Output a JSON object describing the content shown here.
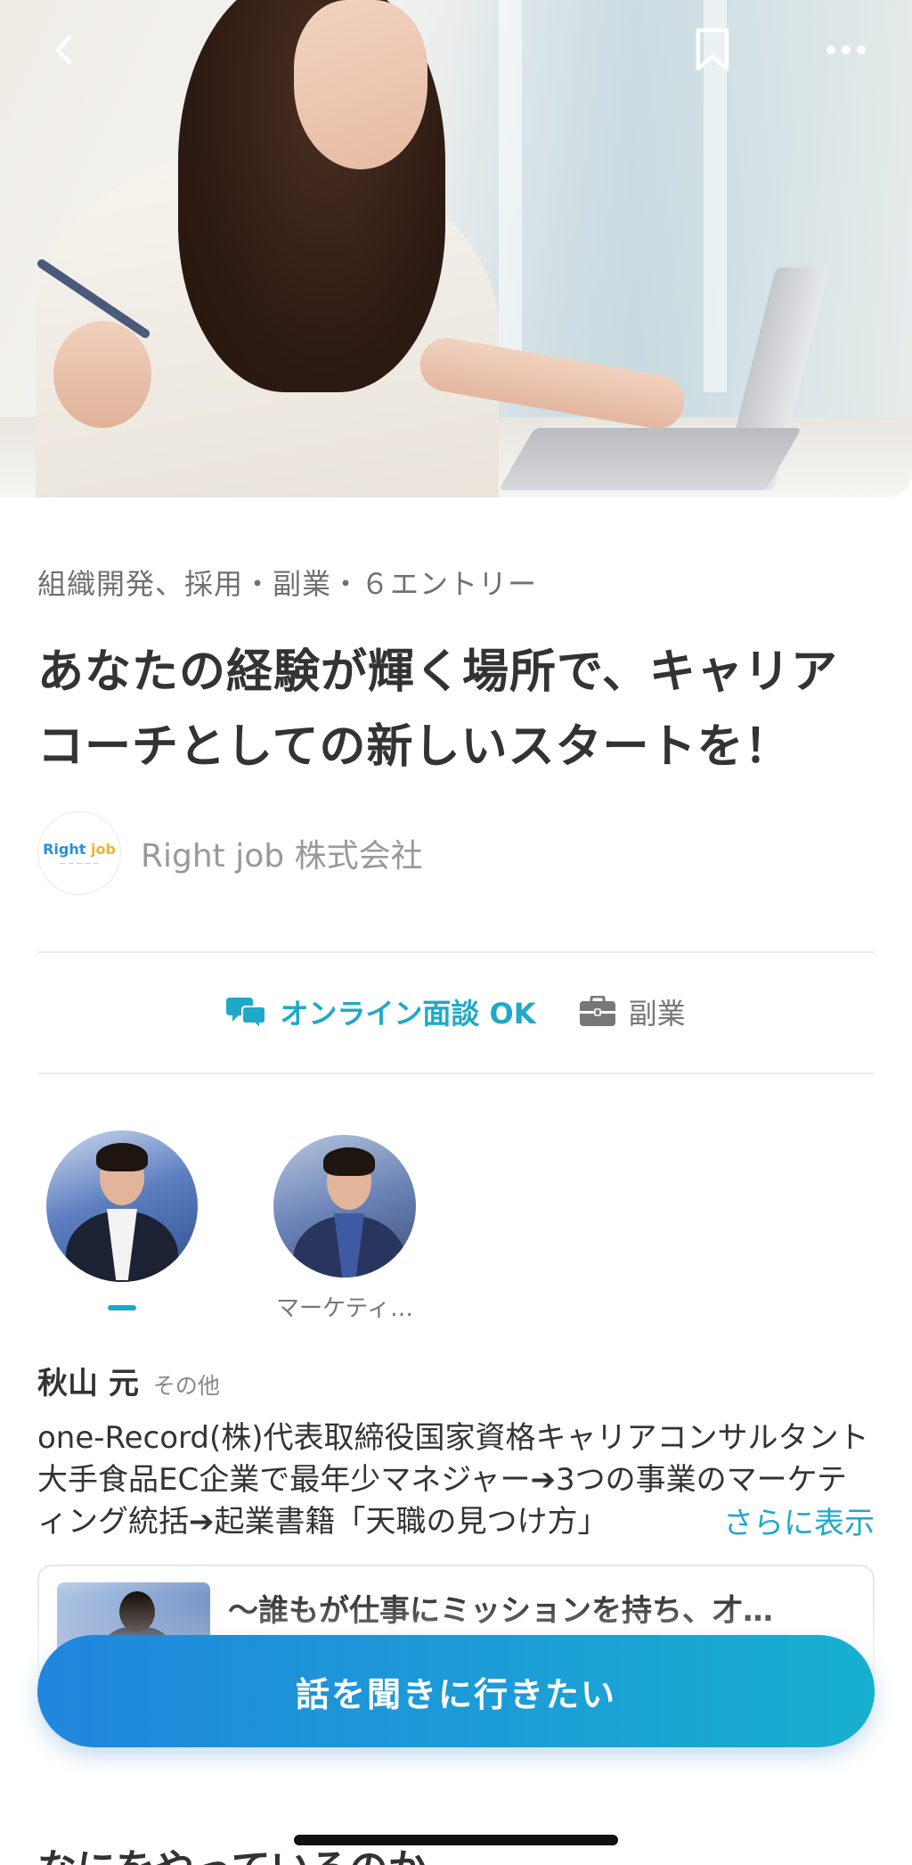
{
  "header": {
    "back_icon": "chevron-left-icon",
    "bookmark_icon": "bookmark-icon",
    "more_icon": "more-horizontal-icon"
  },
  "job": {
    "meta": "組織開発、採用・副業・６エントリー",
    "title": "あなたの経験が輝く場所で、キャリアコーチとしての新しいスタートを！",
    "company_name": "Right job 株式会社",
    "company_logo_text_a": "Right ",
    "company_logo_text_b": "job"
  },
  "tags": {
    "online": "オンライン面談 OK",
    "side_job": "副業"
  },
  "members": [
    {
      "label": ""
    },
    {
      "label": "マーケティ…"
    }
  ],
  "person": {
    "name": "秋山 元",
    "role": "その他",
    "bio": "one-Record(株)代表取締役国家資格キャリアコンサルタント大手食品EC企業で最年少マネジャー➔3つの事業のマーケティング統括➔起業書籍「天職の見つけ方」",
    "more_link": "さらに表示"
  },
  "story": {
    "title": "〜誰もが仕事にミッションを持ち、才…"
  },
  "cta": {
    "label": "話を聞きに行きたい"
  },
  "section": {
    "heading": "なにをやっているのか"
  },
  "colors": {
    "accent": "#1fa9c9",
    "cta_start": "#2186dd",
    "cta_end": "#17b0cf",
    "text": "#333333",
    "muted": "#777777"
  }
}
